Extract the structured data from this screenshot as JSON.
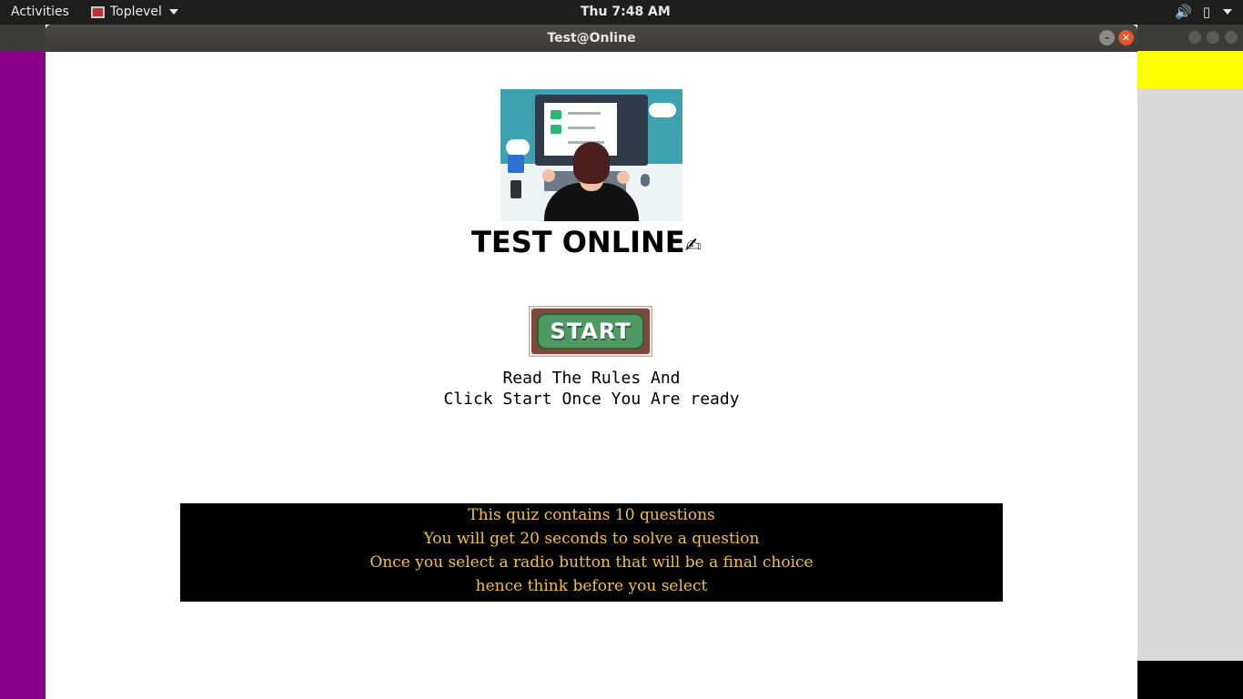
{
  "topbar": {
    "activities": "Activities",
    "app_name": "Toplevel",
    "clock": "Thu  7:48 AM"
  },
  "window": {
    "title": "Test@Online"
  },
  "main": {
    "title": "TEST ONLINE",
    "title_emoji": "✍",
    "start_label": "START",
    "hint_line1": "Read The Rules And",
    "hint_line2": "Click Start Once You Are ready",
    "rules": [
      "This quiz contains 10 questions",
      "You will get 20 seconds to solve a question",
      "Once you select a radio button that will be a final choice",
      "hence think before you select"
    ]
  },
  "colors": {
    "rules_text": "#f0c040",
    "rules_bg": "#000000",
    "desktop_purple": "#870087",
    "accent_yellow": "#ffff00"
  }
}
